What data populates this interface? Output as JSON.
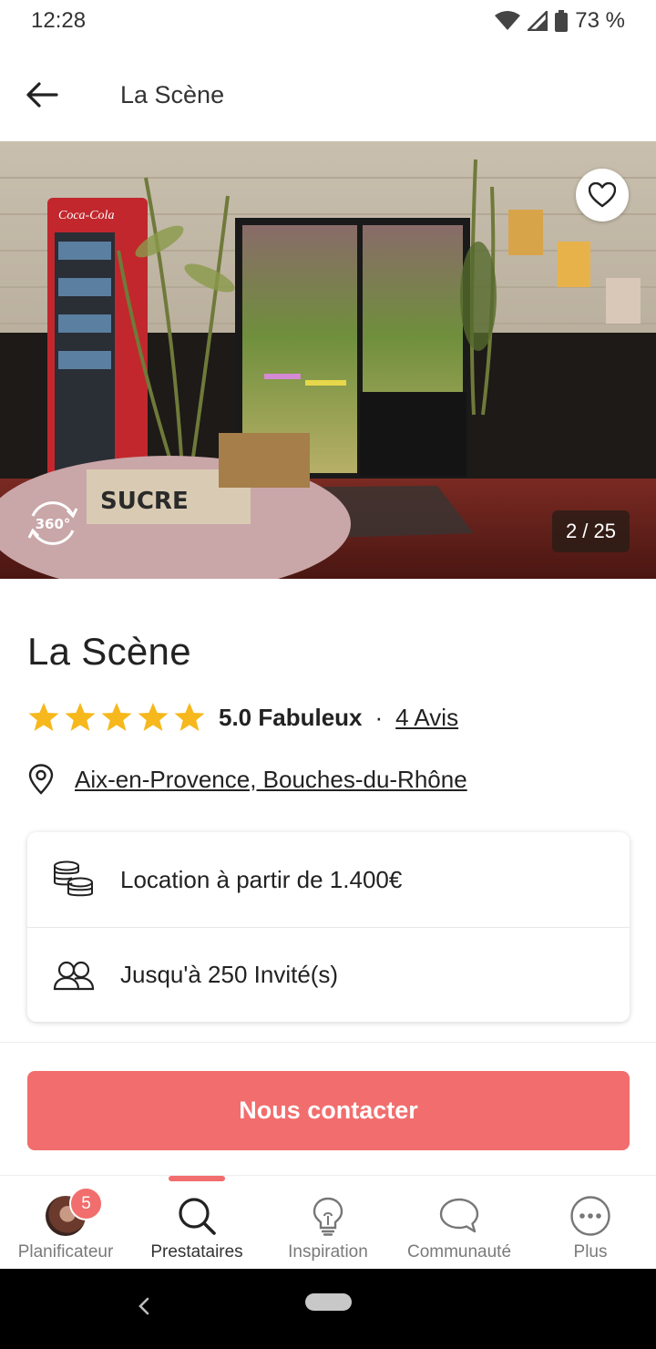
{
  "status_bar": {
    "time": "12:28",
    "battery": "73 %"
  },
  "app_bar": {
    "title": "La Scène"
  },
  "gallery": {
    "counter": "2 / 25",
    "pano_label": "360°",
    "sign_text": "SUCRE",
    "cooler_brand": "Coca-Cola"
  },
  "venue": {
    "name": "La Scène",
    "rating": 5,
    "rating_text": "5.0 Fabuleux",
    "separator": "·",
    "reviews": "4 Avis",
    "location": "Aix-en-Provence, Bouches-du-Rhône",
    "price_text": "Location à partir de 1.400€",
    "guests_text": "Jusqu'à 250 Invité(s)"
  },
  "cta": {
    "label": "Nous contacter"
  },
  "nav": {
    "items": [
      {
        "label": "Planificateur",
        "icon": "avatar",
        "badge": "5"
      },
      {
        "label": "Prestataires",
        "icon": "search-icon",
        "active": true
      },
      {
        "label": "Inspiration",
        "icon": "lightbulb-icon"
      },
      {
        "label": "Communauté",
        "icon": "chat-icon"
      },
      {
        "label": "Plus",
        "icon": "more-icon"
      }
    ]
  },
  "colors": {
    "accent": "#f26d6d",
    "star": "#f6b81c"
  }
}
